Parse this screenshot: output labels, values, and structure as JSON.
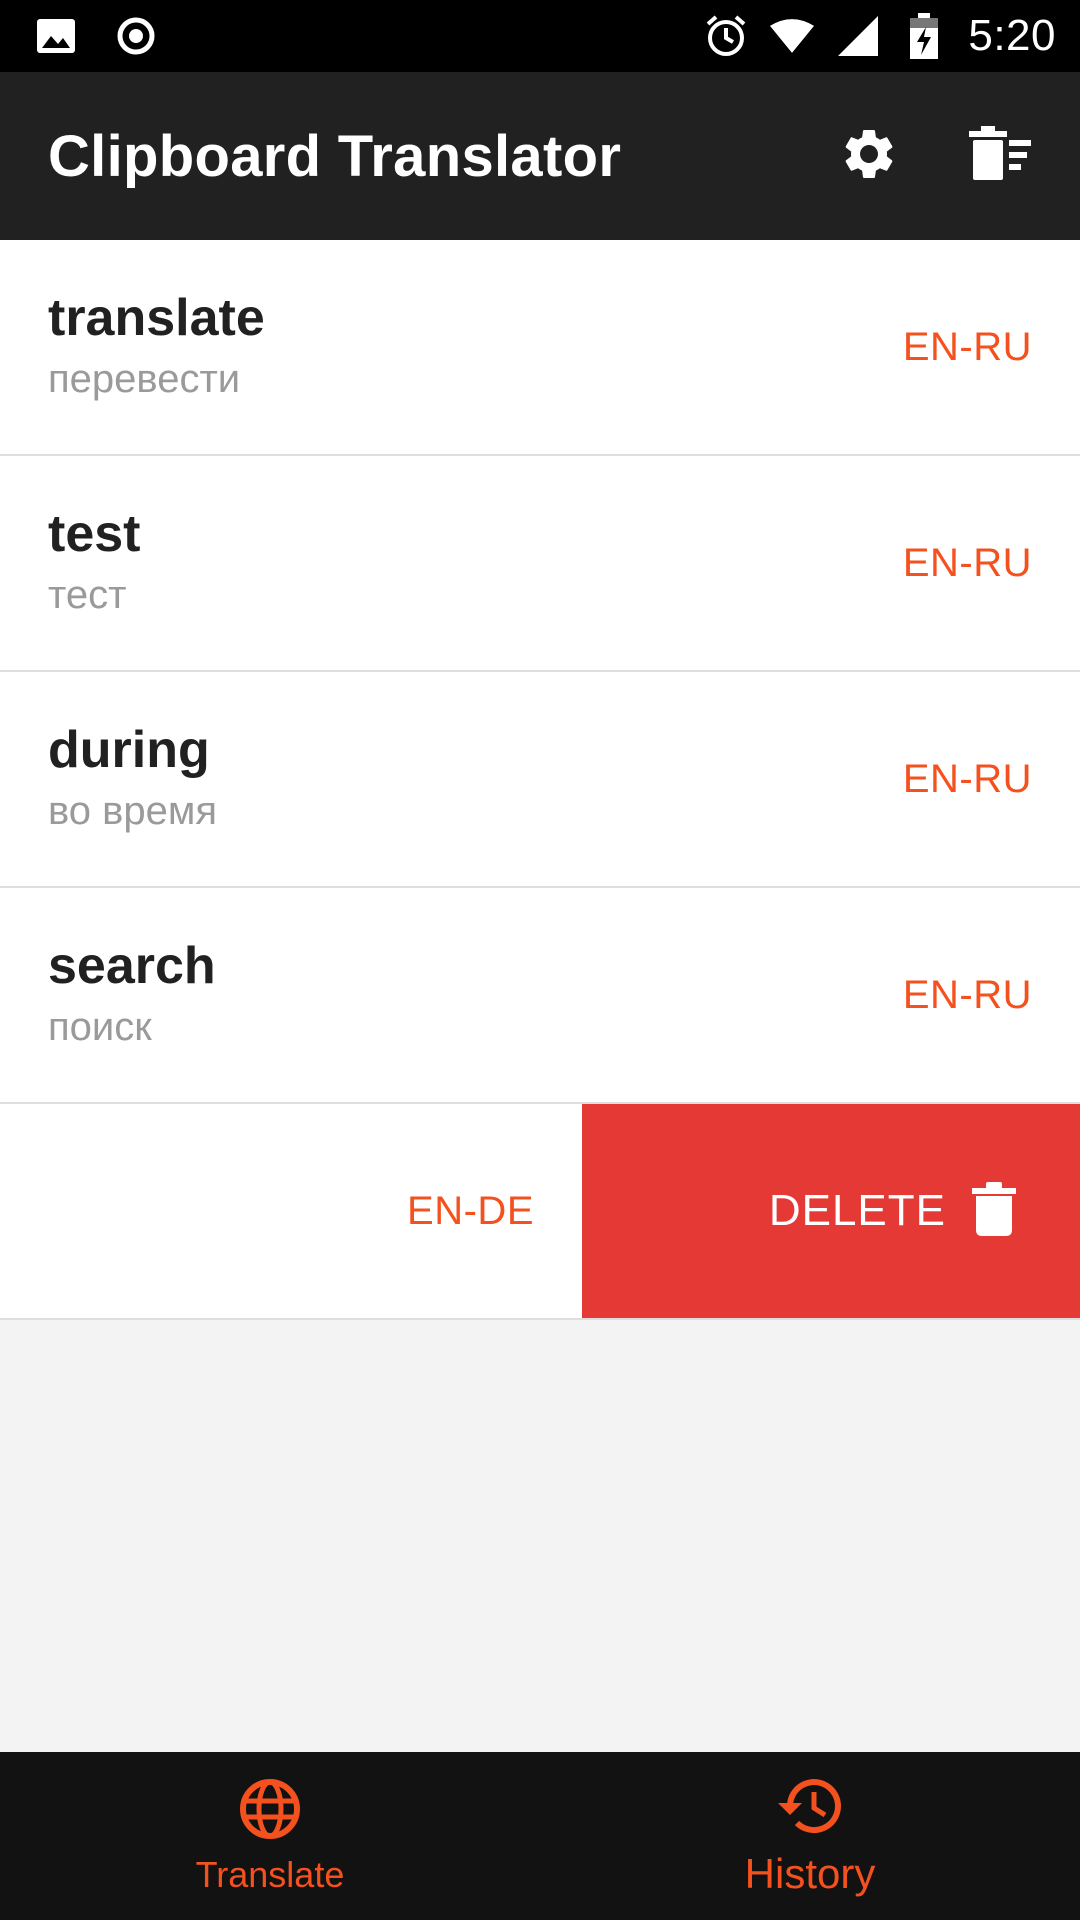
{
  "status_bar": {
    "time": "5:20",
    "icons": [
      "image-icon",
      "record-icon",
      "alarm-icon",
      "wifi-icon",
      "signal-icon",
      "battery-charging-icon"
    ]
  },
  "app_bar": {
    "title": "Clipboard Translator",
    "actions": [
      "settings-icon",
      "clear-history-icon"
    ]
  },
  "history": [
    {
      "word": "translate",
      "translation": "перевести",
      "lang": "EN-RU"
    },
    {
      "word": "test",
      "translation": "тест",
      "lang": "EN-RU"
    },
    {
      "word": "during",
      "translation": "во время",
      "lang": "EN-RU"
    },
    {
      "word": "search",
      "translation": "поиск",
      "lang": "EN-RU"
    }
  ],
  "swiped_item": {
    "lang": "EN-DE",
    "delete_label": "DELETE"
  },
  "bottom_nav": {
    "translate_label": "Translate",
    "history_label": "History"
  },
  "colors": {
    "accent": "#f4511e",
    "delete": "#e53935",
    "app_bar": "#212121"
  }
}
